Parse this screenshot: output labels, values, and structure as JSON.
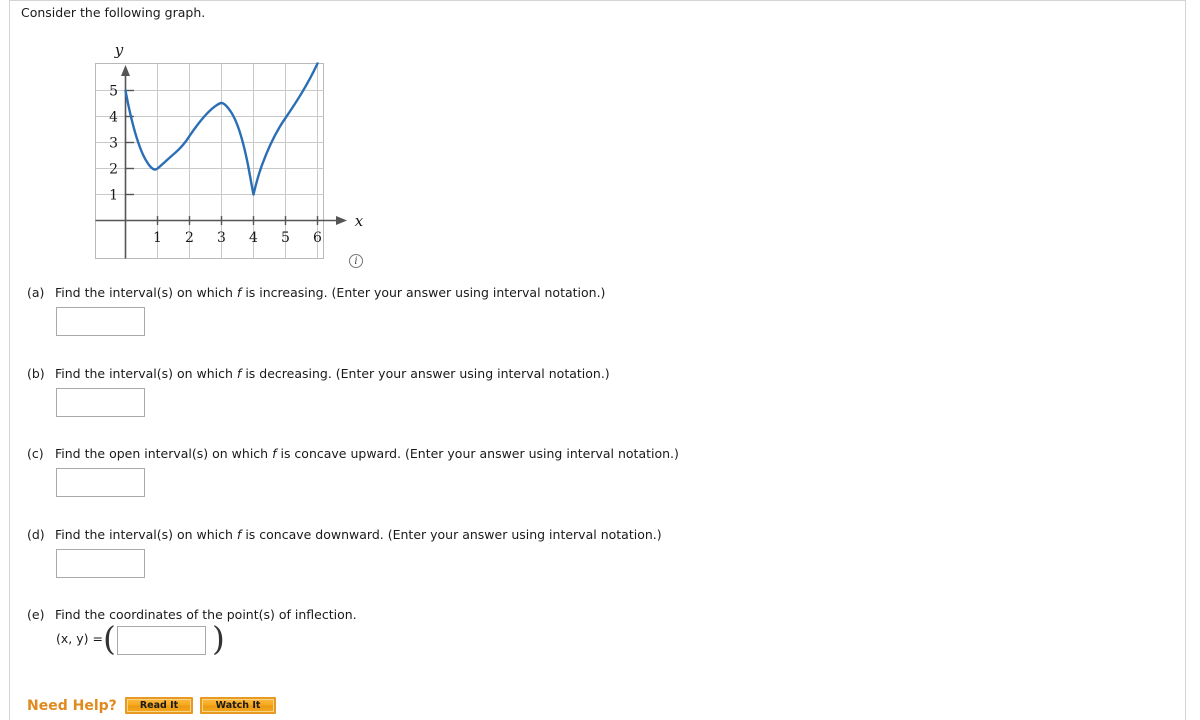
{
  "prompt": "Consider the following graph.",
  "graph": {
    "x_axis_label": "x",
    "y_axis_label": "y",
    "x_ticks": [
      "1",
      "2",
      "3",
      "4",
      "5",
      "6"
    ],
    "y_ticks": [
      "1",
      "2",
      "3",
      "4",
      "5"
    ],
    "info_icon_label": "i",
    "curve_color": "#2a6eb5",
    "grid_color": "#c9c9c9",
    "axis_color": "#555555"
  },
  "chart_data": {
    "type": "line",
    "title": "",
    "xlabel": "x",
    "ylabel": "y",
    "xlim": [
      -0.6,
      6.9
    ],
    "ylim": [
      -1.1,
      6.3
    ],
    "xticks": [
      1,
      2,
      3,
      4,
      5,
      6
    ],
    "yticks": [
      1,
      2,
      3,
      4,
      5
    ],
    "grid": true,
    "legend": "none",
    "series": [
      {
        "name": "f",
        "points": [
          [
            0.0,
            5.0
          ],
          [
            0.25,
            3.7
          ],
          [
            0.5,
            2.85
          ],
          [
            0.75,
            2.25
          ],
          [
            1.0,
            2.0
          ],
          [
            1.25,
            2.12
          ],
          [
            1.5,
            2.42
          ],
          [
            1.75,
            2.75
          ],
          [
            2.0,
            3.02
          ],
          [
            2.25,
            3.32
          ],
          [
            2.5,
            3.6
          ],
          [
            2.75,
            3.88
          ],
          [
            3.0,
            4.0
          ],
          [
            3.25,
            3.88
          ],
          [
            3.5,
            3.5
          ],
          [
            3.75,
            2.6
          ],
          [
            4.0,
            1.0
          ],
          [
            4.25,
            2.35
          ],
          [
            4.5,
            3.3
          ],
          [
            4.75,
            4.05
          ],
          [
            5.0,
            4.55
          ],
          [
            5.25,
            4.95
          ],
          [
            5.5,
            5.35
          ],
          [
            5.75,
            5.7
          ],
          [
            6.0,
            6.1
          ]
        ]
      }
    ],
    "annotations": {
      "local_min_1": [
        1,
        2
      ],
      "local_max": [
        3,
        4
      ],
      "cusp_min": [
        4,
        1
      ],
      "start_point": [
        0,
        5
      ]
    }
  },
  "parts": [
    {
      "label": "(a)",
      "text_before": "Find the interval(s) on which",
      "italic": "f",
      "text_after": "is increasing. (Enter your answer using interval notation.)",
      "answer_value": "",
      "answer_placeholder": ""
    },
    {
      "label": "(b)",
      "text_before": "Find the interval(s) on which",
      "italic": "f",
      "text_after": "is decreasing. (Enter your answer using interval notation.)",
      "answer_value": "",
      "answer_placeholder": ""
    },
    {
      "label": "(c)",
      "text_before": "Find the open interval(s) on which",
      "italic": "f",
      "text_after": "is concave upward. (Enter your answer using interval notation.)",
      "answer_value": "",
      "answer_placeholder": ""
    },
    {
      "label": "(d)",
      "text_before": "Find the interval(s) on which",
      "italic": "f",
      "text_after": "is concave downward. (Enter your answer using interval notation.)",
      "answer_value": "",
      "answer_placeholder": ""
    }
  ],
  "part_e": {
    "label": "(e)",
    "text": "Find the coordinates of the point(s) of inflection.",
    "coord_label": "(x, y) =",
    "answer_value": "",
    "answer_placeholder": ""
  },
  "need_help": {
    "label": "Need Help?",
    "read_it": "Read It",
    "watch_it": "Watch It",
    "accent_color": "#e08a1e"
  }
}
